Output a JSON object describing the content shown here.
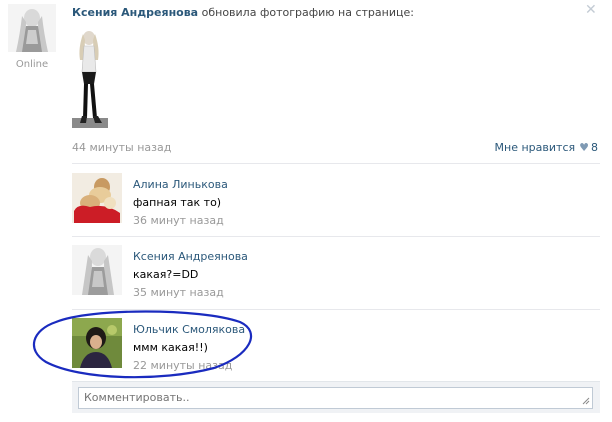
{
  "post": {
    "author": "Ксения Андреянова",
    "action": "обновила фотографию на странице:",
    "status": "Online",
    "time": "44 минуты назад",
    "like_label": "Мне нравится",
    "like_count": "8",
    "close_icon": "close-icon",
    "heart_icon": "heart-icon"
  },
  "comments": [
    {
      "author": "Алина Линькова",
      "text": "фапная так то)",
      "time": "36 минут назад"
    },
    {
      "author": "Ксения Андреянова",
      "text": "какая?=DD",
      "time": "35 минут назад"
    },
    {
      "author": "Юльчик Смолякова",
      "text": "ммм какая!!)",
      "time": "22 минуты назад"
    }
  ],
  "composer": {
    "placeholder": "Комментировать.."
  },
  "colors": {
    "link": "#2b587a",
    "muted": "#999999",
    "highlight_ink": "#1a2bbf"
  }
}
